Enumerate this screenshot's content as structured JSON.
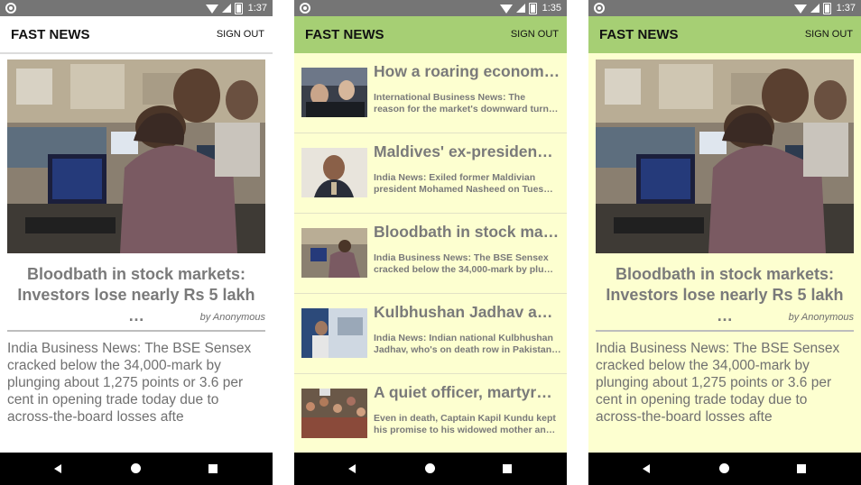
{
  "status": {
    "left_time": "1:37",
    "middle_time": "1:35",
    "right_time": "1:37"
  },
  "app": {
    "title": "FAST NEWS",
    "sign_out": "SIGN OUT"
  },
  "article": {
    "headline": "Bloodbath in stock markets: Investors lose nearly Rs 5 lakh …",
    "author": "by Anonymous",
    "body": "India Business News: The BSE Sensex cracked below the 34,000-mark by plunging about 1,275 points or 3.6 per cent in opening trade today due to across-the-board losses afte"
  },
  "list": {
    "items": [
      {
        "title": "How a roaring econom…",
        "desc_line1": "International Business News: The",
        "desc_line2": "reason for the market's downward turn…"
      },
      {
        "title": "Maldives' ex-presiden…",
        "desc_line1": "India News: Exiled former Maldivian",
        "desc_line2": "president Mohamed Nasheed on Tues…"
      },
      {
        "title": "Bloodbath in stock ma…",
        "desc_line1": "India Business News: The BSE Sensex",
        "desc_line2": "cracked below the 34,000-mark by plu…"
      },
      {
        "title": "Kulbhushan Jadhav ag…",
        "desc_line1": "India News: Indian national Kulbhushan",
        "desc_line2": "Jadhav, who's on death row in Pakistan…"
      },
      {
        "title": "A quiet officer, martyr…",
        "desc_line1": "Even in death, Captain Kapil Kundu kept",
        "desc_line2": "his promise to his widowed mother an…"
      }
    ]
  },
  "colors": {
    "appbar_green": "#a6cf74",
    "background_cream": "#fdffd0",
    "statusbar_gray": "#757575",
    "text_gray": "#7a7a7a"
  },
  "icons": [
    "wifi-icon",
    "signal-icon",
    "battery-icon",
    "back-nav-icon",
    "home-nav-icon",
    "recents-nav-icon",
    "notification-icon"
  ]
}
